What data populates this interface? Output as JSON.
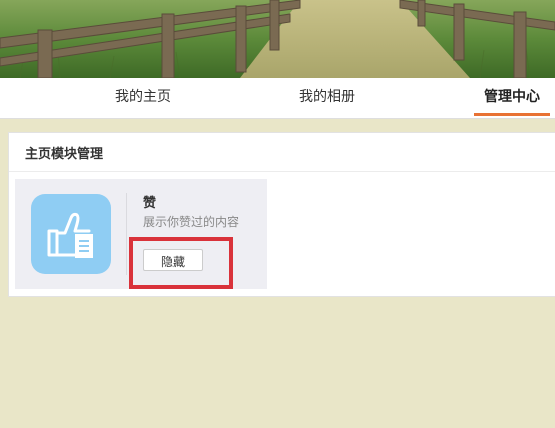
{
  "tabs": [
    {
      "label": "我的主页",
      "active": false
    },
    {
      "label": "我的相册",
      "active": false
    },
    {
      "label": "管理中心",
      "active": true
    }
  ],
  "panel": {
    "title": "主页模块管理",
    "module": {
      "icon": "thumbs-up-icon",
      "name": "赞",
      "description": "展示你赞过的内容",
      "button_label": "隐藏"
    }
  },
  "colors": {
    "accent": "#e87234",
    "highlight": "#d9323a",
    "icon_bg": "#8fcdf3",
    "page_bg": "#e9e6c8"
  }
}
